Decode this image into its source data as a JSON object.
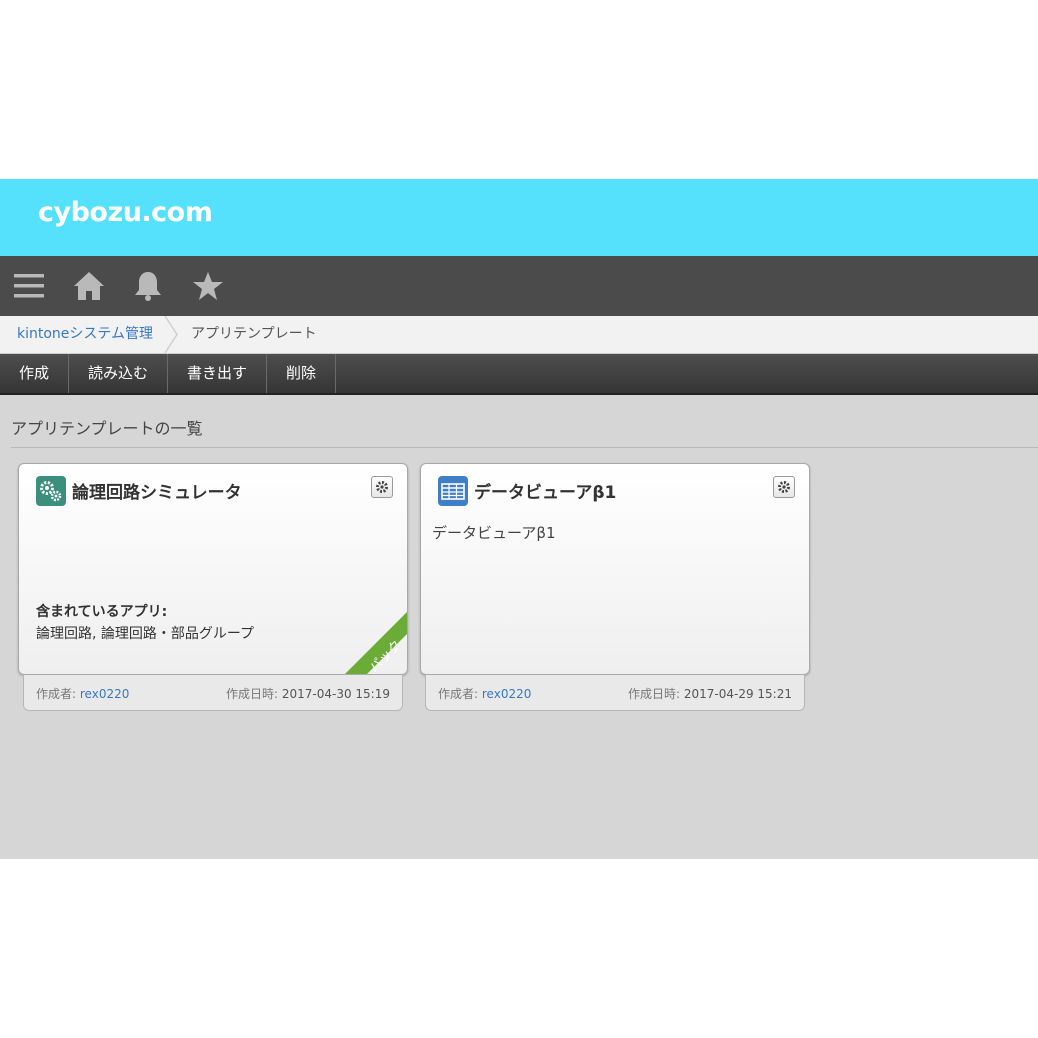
{
  "brand": {
    "logo": "cybozu.com",
    "color": "#55e0fb"
  },
  "nav_icons": [
    "menu-icon",
    "home-icon",
    "bell-icon",
    "star-icon"
  ],
  "breadcrumb": {
    "parent": "kintoneシステム管理",
    "current": "アプリテンプレート"
  },
  "toolbar": {
    "create": "作成",
    "import": "読み込む",
    "export": "書き出す",
    "delete": "削除"
  },
  "list": {
    "title": "アプリテンプレートの一覧",
    "cards": [
      {
        "title": "論理回路シミュレータ",
        "icon": "gears-icon",
        "included_label": "含まれているアプリ:",
        "included_value": "論理回路, 論理回路・部品グループ",
        "badge": "パック",
        "author_label": "作成者:",
        "author": "rex0220",
        "date_label": "作成日時:",
        "date": "2017-04-30 15:19"
      },
      {
        "title": "データビューアβ1",
        "icon": "table-icon",
        "description": "データビューアβ1",
        "author_label": "作成者:",
        "author": "rex0220",
        "date_label": "作成日時:",
        "date": "2017-04-29 15:21"
      }
    ]
  }
}
